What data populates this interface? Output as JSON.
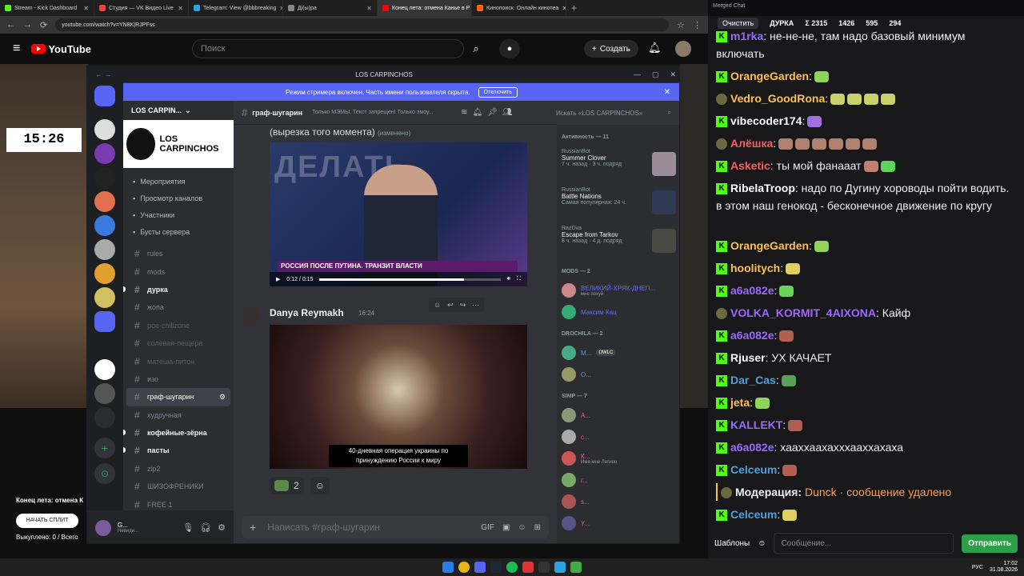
{
  "browser": {
    "tabs": [
      {
        "label": "Stream - Kick Dashboard",
        "color": "#53fc18"
      },
      {
        "label": "Студия — VK Видео Live",
        "color": "#e64646"
      },
      {
        "label": "Telegram: View @bbbreaking",
        "color": "#2aa3e0"
      },
      {
        "label": "Дi(ы)ра",
        "color": "#888888"
      },
      {
        "label": "Конец лета: отмена Канье в Р",
        "color": "#ff0000",
        "active": true
      },
      {
        "label": "Кинопоиск. Онлайн кинотеа",
        "color": "#ff6600"
      }
    ],
    "url": "youtube.com/watch?v=YN8K|RJPFss"
  },
  "youtube": {
    "logo": "YouTube",
    "search_placeholder": "Поиск",
    "create_label": "Создать",
    "clock": "15:26",
    "video_title": "Конец лета: отмена К",
    "split_label": "НАЧАТЬ СПЛИТ",
    "progress_text": "Выкуплено: 0 / Всего"
  },
  "discord": {
    "window_title": "LOS CARPINCHOS",
    "banner_text": "Режим стримера включен. Часть имени пользователя скрыта.",
    "banner_button": "Отключить",
    "server_name": "LOS CARPIN...",
    "server_banner": "LOS CARPINCHOS",
    "menu": [
      "Мероприятия",
      "Просмотр каналов",
      "Участники",
      "Бусты сервера"
    ],
    "channels": [
      {
        "name": "rules",
        "state": "read"
      },
      {
        "name": "mods",
        "state": "read"
      },
      {
        "name": "дурка",
        "state": "unread"
      },
      {
        "name": "жопа",
        "state": "read"
      },
      {
        "name": "poe-chillzone",
        "state": "muted"
      },
      {
        "name": "солевая-пещера",
        "state": "muted"
      },
      {
        "name": "матеша-питон",
        "state": "muted"
      },
      {
        "name": "изо",
        "state": "read"
      },
      {
        "name": "граф-шугарин",
        "state": "selected"
      },
      {
        "name": "худручная",
        "state": "read"
      },
      {
        "name": "кофейные-зёрна",
        "state": "unread"
      },
      {
        "name": "пасты",
        "state": "unread"
      },
      {
        "name": "zip2",
        "state": "read"
      },
      {
        "name": "ШИЗОФРЕНИКИ",
        "state": "read"
      },
      {
        "name": "FREE 1",
        "state": "read"
      }
    ],
    "user": {
      "name": "G...",
      "status": "Невиди..."
    },
    "channel_header": {
      "name": "граф-шугарин",
      "topic": "Только МЭМЫ. Текст запрещен! Только эмоу..."
    },
    "search_placeholder": "Искать «LOS CARPINCHOS»",
    "message1": {
      "caption": "(вырезка того момента)",
      "edited": "(изменено)",
      "video_strap": "РОССИЯ ПОСЛЕ ПУТИНА. ТРАНЗИТ ВЛАСТИ",
      "video_time": "0:12 / 0:15",
      "video_progress": 0.8,
      "bg_text": "ДЕЛАТЬ"
    },
    "message2": {
      "author": "Danya Reymakh",
      "time": "16:24",
      "subtitle": "40-дневная операция украины по принуждению России к миру",
      "reaction_count": "2"
    },
    "composer_placeholder": "Написать #граф-шугарин",
    "activity_header": "Активность — 11",
    "activities": [
      {
        "user": "RussianBot",
        "title": "Summer Clover",
        "meta": "7 ч. назад · 3 ч. подряд",
        "color": "#9b8c9a"
      },
      {
        "user": "RussianBot",
        "title": "Battle Nations",
        "meta": "Самая популярная: 24 ч.",
        "color": "#2f3b55"
      },
      {
        "user": "RazDva",
        "title": "Escape from Tarkov",
        "meta": "8 ч. назад · 4 д. подряд",
        "color": "#4a4a44"
      }
    ],
    "groups": [
      {
        "label": "MODS — 2",
        "members": [
          {
            "name": "ВЕЛИКИЙ-ХРЯК-ДНЕП...",
            "sub": "мне похуй",
            "color": "#6a6ef2",
            "av": "#c88"
          },
          {
            "name": "Максим Кац",
            "sub": "",
            "color": "#6a6ef2",
            "av": "#3a7"
          }
        ]
      },
      {
        "label": "DROCHILA — 2",
        "members": [
          {
            "name": "М...",
            "sub": "",
            "color": "#4aa3e0",
            "av": "#4a8",
            "tag": "OWLC"
          },
          {
            "name": "О...",
            "sub": "",
            "color": "#4aa3e0",
            "av": "#996"
          }
        ]
      },
      {
        "label": "SIMP — 7",
        "members": [
          {
            "name": "А...",
            "sub": "",
            "color": "#e85aa0",
            "av": "#897"
          },
          {
            "name": "c...",
            "sub": "",
            "color": "#e85aa0",
            "av": "#aaa"
          },
          {
            "name": "К...",
            "sub": "Имя мне Легион",
            "color": "#e85aa0",
            "av": "#c55"
          },
          {
            "name": "г...",
            "sub": "",
            "color": "#e85aa0",
            "av": "#7a6"
          },
          {
            "name": "s...",
            "sub": "",
            "color": "#e85aa0",
            "av": "#a55"
          },
          {
            "name": "Y...",
            "sub": "",
            "color": "#e85aa0",
            "av": "#558"
          }
        ]
      }
    ]
  },
  "chat": {
    "window_title": "Merged Chat",
    "clear_label": "Очистить",
    "stats": [
      "ДУРКА",
      "Σ 2315",
      "1426",
      "595",
      "294"
    ],
    "messages": [
      {
        "user": "m1rka",
        "color": "#9b6bff",
        "text": ": не-не-не, там надо базовый минимум включать",
        "lines": 2,
        "emotes": []
      },
      {
        "user": "OrangeGarden",
        "color": "#ffc14d",
        "text": ":",
        "lines": 1,
        "emotes": [
          "#8fd35a"
        ]
      },
      {
        "user": "Vedro_GoodRona",
        "color": "#ffc14d",
        "text": ":",
        "lines": 1,
        "emotes": [
          "#c7d36a",
          "#c7d36a",
          "#c7d36a",
          "#c7d36a"
        ],
        "kind": "avatar"
      },
      {
        "user": "vibecoder174",
        "color": "#ffffff",
        "text": ":",
        "lines": 1,
        "emotes": [
          "#a070e0"
        ]
      },
      {
        "user": "Алёшка",
        "color": "#ff5c5c",
        "text": ":",
        "lines": 1,
        "emotes": [
          "#b08070",
          "#b08070",
          "#b08070",
          "#b08070",
          "#b08070",
          "#b08070"
        ],
        "kind": "avatar"
      },
      {
        "user": "Asketic",
        "color": "#ff5c5c",
        "text": ": ты мой фанааат",
        "lines": 1,
        "emotes": [
          "#c08070",
          "#5fd35a"
        ]
      },
      {
        "user": "RibelaTroop",
        "color": "#ffffff",
        "text": ": надо по Дугину хороводы пойти водить. в этом наш генокод - бесконечное движение по кругу",
        "lines": 3,
        "emotes": []
      },
      {
        "user": "OrangeGarden",
        "color": "#ffc14d",
        "text": ":",
        "lines": 1,
        "emotes": [
          "#8fd35a"
        ]
      },
      {
        "user": "hoolitych",
        "color": "#ffc14d",
        "text": ":",
        "lines": 1,
        "emotes": [
          "#e0d060"
        ]
      },
      {
        "user": "a6a082e",
        "color": "#9b6bff",
        "text": ":",
        "lines": 1,
        "emotes": [
          "#6cd35a"
        ]
      },
      {
        "user": "VOLKA_KORMIT_4AIXONA",
        "color": "#9b6bff",
        "text": ": Кайф",
        "lines": 1,
        "emotes": [],
        "kind": "avatar"
      },
      {
        "user": "a6a082e",
        "color": "#9b6bff",
        "text": ":",
        "lines": 1,
        "emotes": [
          "#b06050"
        ]
      },
      {
        "user": "Rjuser",
        "color": "#ffffff",
        "text": ": УХ КАЧАЕТ",
        "lines": 1,
        "emotes": []
      },
      {
        "user": "Dar_Cas",
        "color": "#4aa3e0",
        "text": ":",
        "lines": 1,
        "emotes": [
          "#5aa05a"
        ]
      },
      {
        "user": "jeta",
        "color": "#ffc14d",
        "text": ":",
        "lines": 1,
        "emotes": [
          "#8fd35a"
        ]
      },
      {
        "user": "KALLEKT",
        "color": "#9b6bff",
        "text": ":",
        "lines": 1,
        "emotes": [
          "#b06050"
        ]
      },
      {
        "user": "a6a082e",
        "color": "#9b6bff",
        "text": ": хааххаахахххааххахаха",
        "lines": 1,
        "emotes": []
      },
      {
        "user": "Celceum",
        "color": "#4aa3e0",
        "text": ":",
        "lines": 1,
        "emotes": [
          "#b06050"
        ]
      },
      {
        "user": "Модерация: ",
        "color": "#efeff1",
        "text": "Dunck · сообщение удалено",
        "lines": 1,
        "emotes": [],
        "kind": "mod"
      },
      {
        "user": "Celceum",
        "color": "#4aa3e0",
        "text": ":",
        "lines": 1,
        "emotes": [
          "#e0d060"
        ]
      }
    ],
    "templates_label": "Шаблоны",
    "input_placeholder": "Сообщение...",
    "send_label": "Отправить"
  },
  "taskbar": {
    "lang": "РУС",
    "time": "17:02",
    "date": "31.08.2026"
  }
}
